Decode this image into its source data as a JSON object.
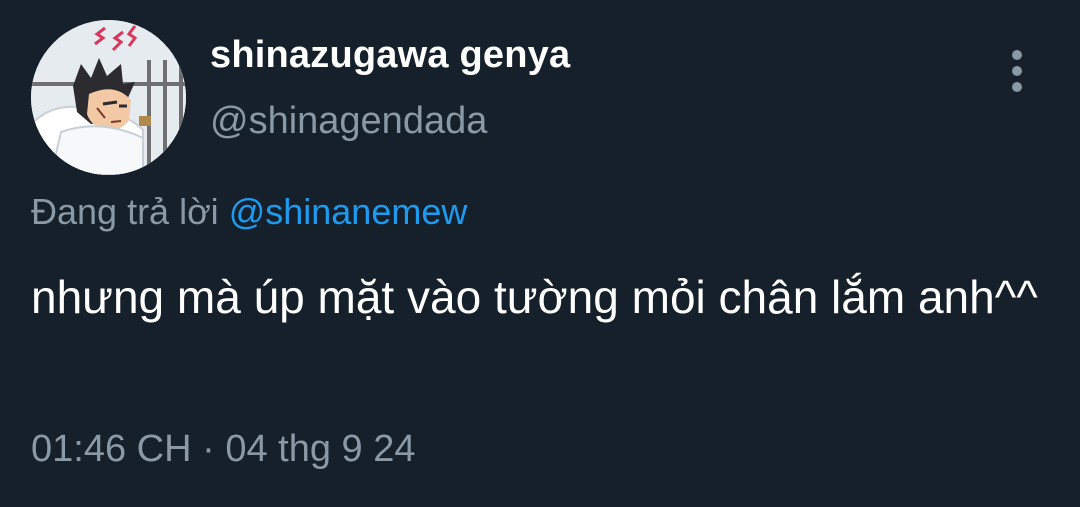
{
  "author": {
    "display_name": "shinazugawa genya",
    "handle": "@shinagendada"
  },
  "reply": {
    "prefix": "Đang trả lời",
    "mention": "@shinanemew"
  },
  "tweet": {
    "text": "nhưng mà úp mặt vào tường mỏi chân lắm anh^^"
  },
  "meta": {
    "time": "01:46 CH",
    "separator": " · ",
    "date": "04 thg 9 24"
  },
  "icons": {
    "more": "more-vertical-icon",
    "avatar": "avatar-image"
  },
  "colors": {
    "background": "#15202b",
    "primary_text": "#ffffff",
    "secondary_text": "#8b98a5",
    "accent": "#1d9bf0"
  }
}
